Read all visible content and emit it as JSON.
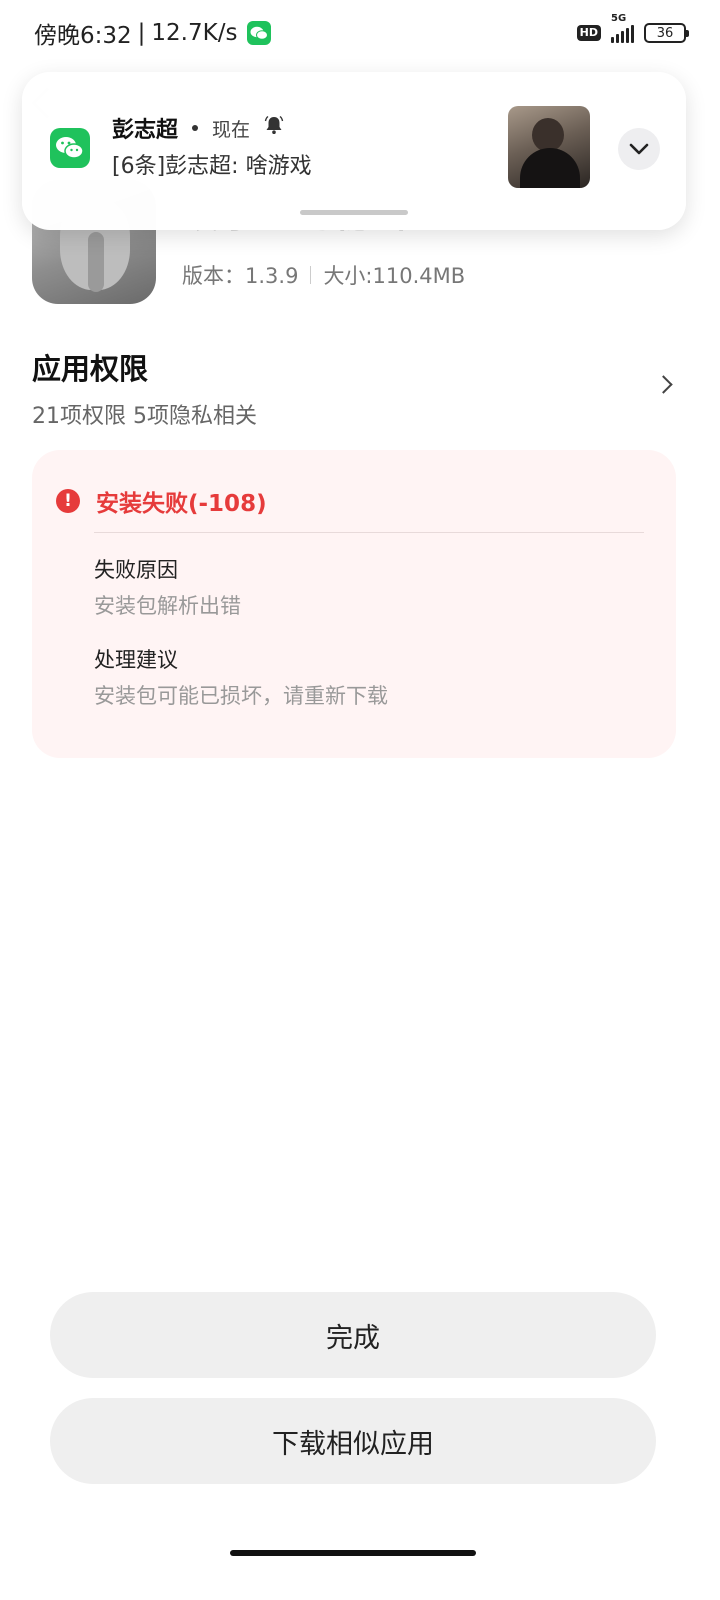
{
  "status_bar": {
    "time": "傍晚6:32",
    "net_speed": "12.7K/s",
    "hd": "HD",
    "network": "5G",
    "battery": "36"
  },
  "app": {
    "name": "故事里的秘密",
    "version": "版本：1.3.9",
    "size": "大小:110.4MB"
  },
  "permissions": {
    "title": "应用权限",
    "summary": "21项权限 5项隐私相关"
  },
  "error": {
    "icon_glyph": "!",
    "title": "安装失败(-108)",
    "reason_label": "失败原因",
    "reason_value": "安装包解析出错",
    "advice_label": "处理建议",
    "advice_value": "安装包可能已损坏，请重新下载",
    "color": "#e63b3b"
  },
  "notification": {
    "app_icon": "wechat-icon",
    "sender": "彭志超",
    "time": "现在",
    "message": "[6条]彭志超: 啥游戏"
  },
  "buttons": {
    "done": "完成",
    "download_similar": "下载相似应用"
  }
}
